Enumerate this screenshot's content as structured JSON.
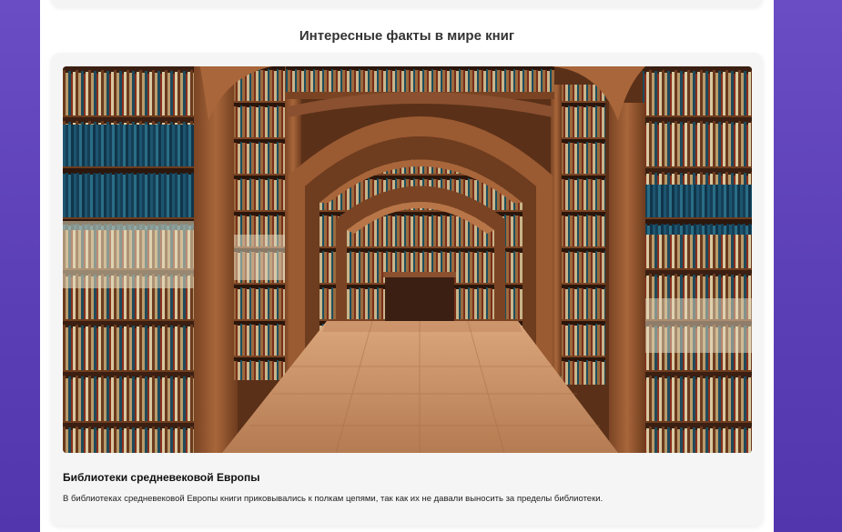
{
  "section": {
    "title": "Интересные факты в мире книг"
  },
  "fact_card": {
    "image_alt": "Арочные залы старинной библиотеки с деревянными книжными шкафами",
    "heading": "Библиотеки средневековой Европы",
    "text": "В библиотеках средневековой Европы книги приковывались к полкам цепями, так как их не давали выносить за пределы библиотеки."
  },
  "colors": {
    "background": "#5a3eb6",
    "card": "#f5f5f5",
    "wood": "#9a5a32",
    "floor": "#c8946a"
  }
}
